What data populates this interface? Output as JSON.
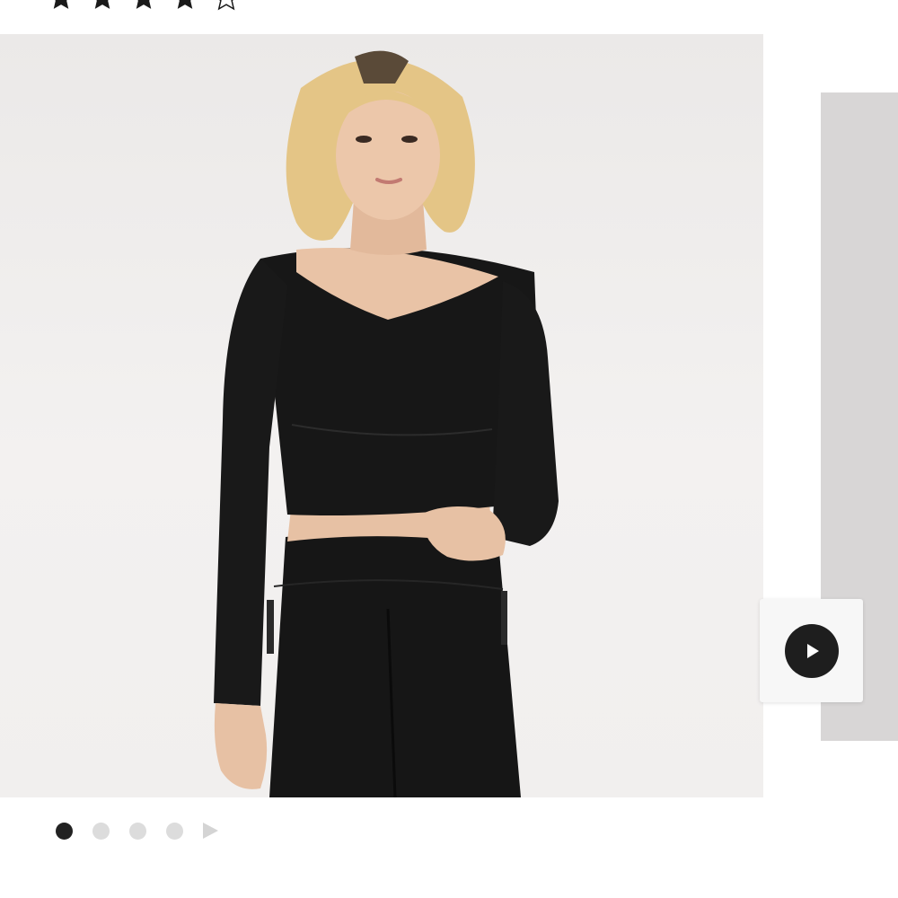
{
  "product": {
    "rating": {
      "stars_filled": 4,
      "stars_total": 5,
      "count_text": ""
    },
    "gallery": {
      "main_image": {
        "icon": "product-photo",
        "alt": ""
      },
      "next_image_peek": true,
      "video_button": {
        "icon": "play-icon"
      },
      "pagination": {
        "total_dots": 4,
        "active_index": 0,
        "next_icon": "triangle-right-icon"
      }
    }
  },
  "colors": {
    "star": "#1a1a1a",
    "active_dot": "#222222",
    "inactive_dot": "#dcdcdc",
    "play_button": "#1e1e1e"
  }
}
